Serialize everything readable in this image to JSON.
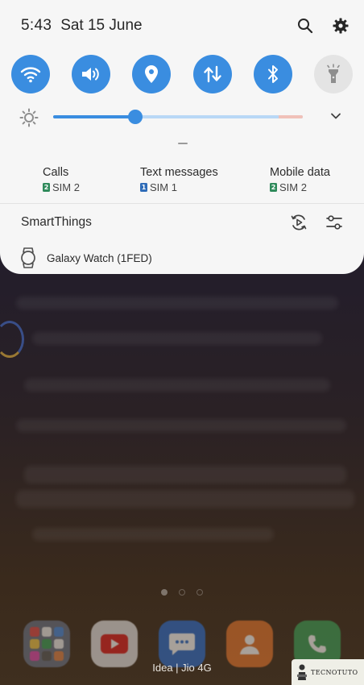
{
  "status": {
    "time": "5:43",
    "date": "Sat 15 June"
  },
  "quick_toggles": [
    {
      "name": "wifi",
      "icon": "wifi-icon",
      "active": true
    },
    {
      "name": "sound",
      "icon": "volume-icon",
      "active": true
    },
    {
      "name": "location",
      "icon": "location-pin-icon",
      "active": true
    },
    {
      "name": "mobile-data",
      "icon": "data-arrows-icon",
      "active": true
    },
    {
      "name": "bluetooth",
      "icon": "bluetooth-icon",
      "active": true
    },
    {
      "name": "flashlight",
      "icon": "flashlight-icon",
      "active": false
    }
  ],
  "brightness": {
    "level": 0.33
  },
  "sim_settings": {
    "calls": {
      "title": "Calls",
      "sim_number": "2",
      "sim_label": "SIM 2"
    },
    "text_messages": {
      "title": "Text messages",
      "sim_number": "1",
      "sim_label": "SIM 1"
    },
    "mobile_data": {
      "title": "Mobile data",
      "sim_number": "2",
      "sim_label": "SIM 2"
    }
  },
  "smartthings": {
    "label": "SmartThings"
  },
  "device": {
    "label": "Galaxy Watch (1FED)"
  },
  "homescreen": {
    "carrier": "Idea | Jio 4G",
    "watermark": "TECNOTUTO"
  },
  "colors": {
    "accent": "#3a8de0",
    "panel_background": "#f6f6f6",
    "sim_green": "#2f8a5b",
    "sim_blue": "#2f6cb8"
  }
}
